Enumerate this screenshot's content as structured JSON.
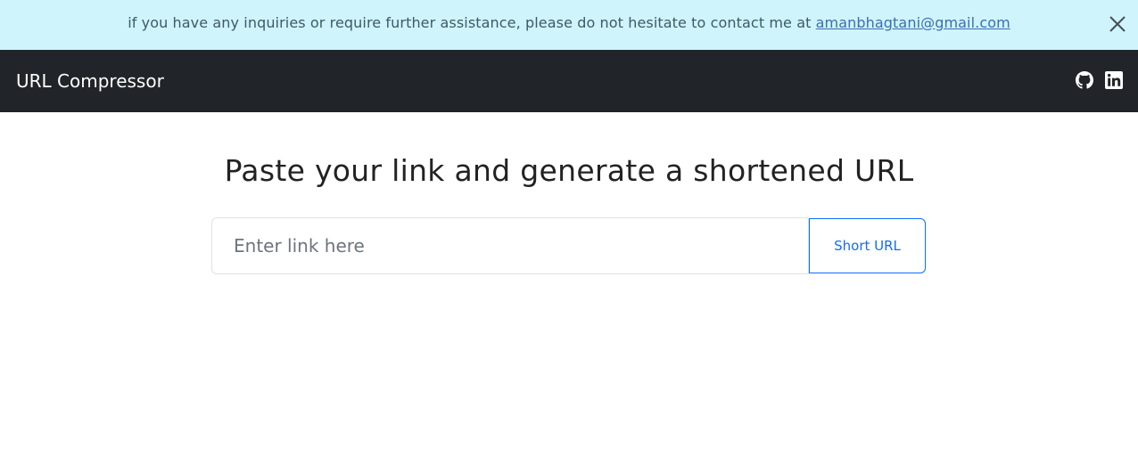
{
  "alert": {
    "message": "if you have any inquiries or require further assistance, please do not hesitate to contact me at ",
    "email": "amanbhagtani@gmail.com",
    "close_icon": "close-icon"
  },
  "navbar": {
    "brand": "URL Compressor",
    "icons": [
      "github-icon",
      "linkedin-icon"
    ]
  },
  "main": {
    "heading": "Paste your link and generate a shortened URL",
    "input_placeholder": "Enter link here",
    "input_value": "",
    "button_label": "Short URL"
  },
  "colors": {
    "alert_bg": "#cff4fc",
    "navbar_bg": "#212529",
    "primary": "#0d6efd"
  }
}
